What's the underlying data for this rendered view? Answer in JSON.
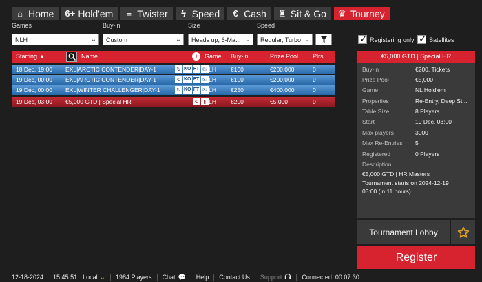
{
  "nav": {
    "tabs": [
      {
        "label": "Home",
        "icon": "home-icon",
        "glyph": "⌂",
        "active": false
      },
      {
        "label": "Hold'em",
        "icon": "six-plus-icon",
        "glyph": "6+",
        "active": false
      },
      {
        "label": "Twister",
        "icon": "twister-icon",
        "glyph": "≡",
        "active": false
      },
      {
        "label": "Speed",
        "icon": "lightning-icon",
        "glyph": "ϟ",
        "active": false
      },
      {
        "label": "Cash",
        "icon": "euro-coin-icon",
        "glyph": "€",
        "active": false
      },
      {
        "label": "Sit & Go",
        "icon": "trophy-icon",
        "glyph": "♜",
        "active": false
      },
      {
        "label": "Tourney",
        "icon": "trophy-icon",
        "glyph": "♛",
        "active": true
      }
    ]
  },
  "filters": {
    "games": {
      "label": "Games",
      "value": "NLH"
    },
    "buyin": {
      "label": "Buy-in",
      "value": "Custom"
    },
    "size": {
      "label": "Size",
      "value": "Heads up, 6-Ma..."
    },
    "speed": {
      "label": "Speed",
      "value": "Regular, Turbo"
    },
    "registering_only": {
      "label": "Registering only",
      "checked": true
    },
    "satellites": {
      "label": "Satellites",
      "checked": true
    }
  },
  "table": {
    "headers": {
      "starting": "Starting ▲",
      "name": "Name",
      "game": "Game",
      "buyin": "Buy-in",
      "prize_pool": "Prize Pool",
      "players": "Plrs"
    },
    "rows": [
      {
        "starting": "18 Dec, 19:00",
        "name": "EXL|ARCTIC CONTENDER|DAY-1",
        "badges": [
          "↻",
          "KO",
          "FT",
          "✉"
        ],
        "game": "NLH",
        "buyin": "€100",
        "prize_pool": "€200,000",
        "players": "0",
        "style": "blue"
      },
      {
        "starting": "19 Dec, 00:00",
        "name": "EXL|ARCTIC CONTENDER|DAY-1",
        "badges": [
          "↻",
          "KO",
          "FT",
          "✉"
        ],
        "game": "NLH",
        "buyin": "€100",
        "prize_pool": "€200,000",
        "players": "0",
        "style": "blue"
      },
      {
        "starting": "19 Dec, 00:00",
        "name": "EXL|WINTER CHALLENGER|DAY-1",
        "badges": [
          "↻",
          "KO",
          "FT",
          "✉"
        ],
        "game": "NLH",
        "buyin": "€250",
        "prize_pool": "€400,000",
        "players": "0",
        "style": "blue"
      },
      {
        "starting": "19 Dec, 03:00",
        "name": "€5,000 GTD | Special HR",
        "badges": [
          "↻",
          "▮"
        ],
        "game": "NLH",
        "buyin": "€200",
        "prize_pool": "€5,000",
        "players": "0",
        "style": "red"
      }
    ]
  },
  "details": {
    "title": "€5,000 GTD | Special HR",
    "fields": [
      {
        "key": "Buy-in",
        "value": "€200, Tickets"
      },
      {
        "key": "Prize Pool",
        "value": "€5,000"
      },
      {
        "key": "Game",
        "value": "NL Hold'em"
      },
      {
        "key": "Properties",
        "value": "Re-Entry, Deep St..."
      },
      {
        "key": "Table Size",
        "value": "8 Players"
      },
      {
        "key": "Start",
        "value": "19 Dec, 03:00"
      },
      {
        "key": "Max players",
        "value": "3000"
      },
      {
        "key": "Max Re-Entries",
        "value": "5"
      },
      {
        "key": "Registered",
        "value": "0 Players"
      }
    ],
    "description_label": "Description",
    "description_lines": [
      "€5,000 GTD | HR Masters",
      "Tournament starts on 2024-12-19",
      "03:00 (in 11 hours)"
    ],
    "lobby_label": "Tournament Lobby",
    "register_label": "Register"
  },
  "status": {
    "date": "12-18-2024",
    "time": "15:45:51",
    "timezone": "Local",
    "players": "1984 Players",
    "chat": "Chat",
    "help": "Help",
    "contact": "Contact Us",
    "support": "Support",
    "connected": "Connected: 00:07:30"
  },
  "colors": {
    "accent": "#d7232f",
    "row_blue": "#3a7fc2",
    "row_red": "#b0242d",
    "star": "#e6a627"
  }
}
